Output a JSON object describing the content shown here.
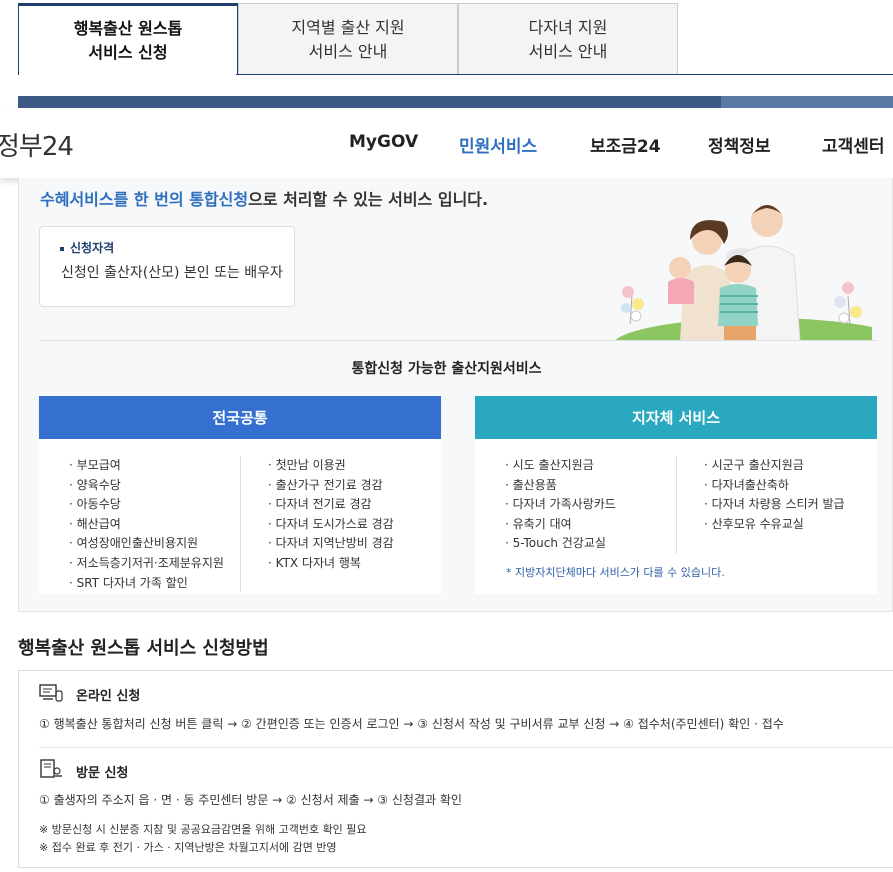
{
  "tabs": [
    {
      "label": "행복출산 원스톱\n서비스 신청",
      "active": true
    },
    {
      "label": "지역별 출산 지원\n서비스 안내",
      "active": false
    },
    {
      "label": "다자녀 지원\n서비스 안내",
      "active": false
    }
  ],
  "header": {
    "logo": "정부24",
    "nav": [
      "MyGOV",
      "민원서비스",
      "보조금24",
      "정책정보",
      "고객센터"
    ],
    "active_nav": "민원서비스",
    "active_color": "#2f6fbf"
  },
  "intro": {
    "highlight": "수혜서비스를 한 번의 통합신청",
    "rest": "으로 처리할 수 있는 서비스 입니다."
  },
  "qualification": {
    "title": "신청자격",
    "value": "신청인 출산자(산모) 본인 또는 배우자"
  },
  "services_title": "통합신청 가능한 출산지원서비스",
  "national": {
    "header": "전국공통",
    "color": "#3570d0",
    "col1": [
      "부모급여",
      "양육수당",
      "아동수당",
      "해산급여",
      "여성장애인출산비용지원",
      "저소득층기저귀·조제분유지원",
      "SRT 다자녀 가족 할인"
    ],
    "col2": [
      "첫만남 이용권",
      "출산가구 전기료 경감",
      "다자녀 전기료 경감",
      "다자녀 도시가스료 경감",
      "다자녀 지역난방비 경감",
      "KTX 다자녀 행복"
    ]
  },
  "local": {
    "header": "지자체 서비스",
    "color": "#2aa8c0",
    "col1": [
      "시도 출산지원금",
      "출산용품",
      "다자녀 가족사랑카드",
      "유축기 대여",
      "5-Touch 건강교실"
    ],
    "col2": [
      "시군구 출산지원금",
      "다자녀출산축하",
      "다자녀 차량용 스티커 발급",
      "산후모유 수유교실"
    ],
    "note": "* 지방자치단체마다 서비스가 다를 수 있습니다."
  },
  "method": {
    "title": "행복출산 원스톱 서비스 신청방법",
    "online_title": "온라인 신청",
    "online_steps": "① 행복출산 통합처리 신청 버튼 클릭 → ② 간편인증 또는 인증서 로그인 → ③ 신청서 작성 및 구비서류 교부 신청 → ④ 접수처(주민센터) 확인 · 접수",
    "visit_title": "방문 신청",
    "visit_steps": "① 출생자의 주소지 읍 · 면 · 동 주민센터 방문 → ② 신청서 제출 → ③ 신청결과 확인",
    "notes": [
      "※ 방문신청 시 신분증 지참 및 공공요금감면을 위해 고객번호 확인 필요",
      "※ 접수 완료 후 전기 · 가스 · 지역난방은 차월고지서에 감면 반영"
    ]
  },
  "icons": [
    "computer-icon",
    "document-stamp-icon",
    "family-illustration"
  ]
}
